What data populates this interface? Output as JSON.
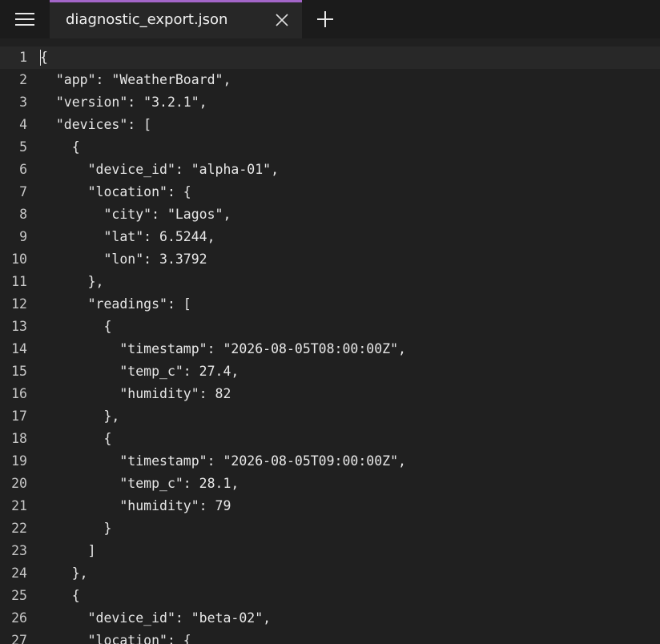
{
  "titlebar": {
    "menu_icon": "hamburger-menu-icon",
    "tab": {
      "title": "diagnostic_export.json",
      "close_icon": "close-icon",
      "accent_color": "#a365c8"
    },
    "new_tab_icon": "plus-icon"
  },
  "editor": {
    "lines": [
      {
        "number": "1",
        "text": "{"
      },
      {
        "number": "2",
        "text": "  \"app\": \"WeatherBoard\","
      },
      {
        "number": "3",
        "text": "  \"version\": \"3.2.1\","
      },
      {
        "number": "4",
        "text": "  \"devices\": ["
      },
      {
        "number": "5",
        "text": "    {"
      },
      {
        "number": "6",
        "text": "      \"device_id\": \"alpha-01\","
      },
      {
        "number": "7",
        "text": "      \"location\": {"
      },
      {
        "number": "8",
        "text": "        \"city\": \"Lagos\","
      },
      {
        "number": "9",
        "text": "        \"lat\": 6.5244,"
      },
      {
        "number": "10",
        "text": "        \"lon\": 3.3792"
      },
      {
        "number": "11",
        "text": "      },"
      },
      {
        "number": "12",
        "text": "      \"readings\": ["
      },
      {
        "number": "13",
        "text": "        {"
      },
      {
        "number": "14",
        "text": "          \"timestamp\": \"2026-08-05T08:00:00Z\","
      },
      {
        "number": "15",
        "text": "          \"temp_c\": 27.4,"
      },
      {
        "number": "16",
        "text": "          \"humidity\": 82"
      },
      {
        "number": "17",
        "text": "        },"
      },
      {
        "number": "18",
        "text": "        {"
      },
      {
        "number": "19",
        "text": "          \"timestamp\": \"2026-08-05T09:00:00Z\","
      },
      {
        "number": "20",
        "text": "          \"temp_c\": 28.1,"
      },
      {
        "number": "21",
        "text": "          \"humidity\": 79"
      },
      {
        "number": "22",
        "text": "        }"
      },
      {
        "number": "23",
        "text": "      ]"
      },
      {
        "number": "24",
        "text": "    },"
      },
      {
        "number": "25",
        "text": "    {"
      },
      {
        "number": "26",
        "text": "      \"device_id\": \"beta-02\","
      },
      {
        "number": "27",
        "text": "      \"location\": {"
      }
    ]
  }
}
